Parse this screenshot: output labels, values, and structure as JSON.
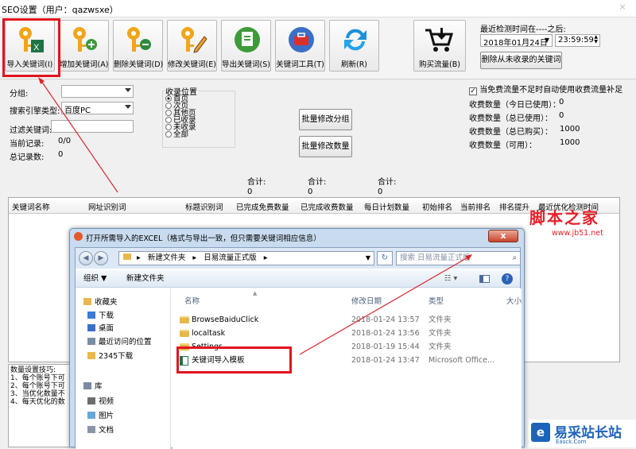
{
  "window": {
    "title": "SEO设置（用户：qazwsxe）",
    "close": "×"
  },
  "toolbar": {
    "buttons": [
      "导入关键词(I)",
      "增加关键词(A)",
      "删除关键词(D)",
      "修改关键词(E)",
      "导出关键词(S)",
      "关键词工具(T)",
      "刷新(R)"
    ],
    "buy_label": "购买流量(B)"
  },
  "detect": {
    "label": "最近检测时间在----之后:",
    "date": "2018年01月24日",
    "time": "23:59:59",
    "delete_btn": "删除从未收录的关键词"
  },
  "filters": {
    "group_label": "分组:",
    "engine_label": "搜索引擎类型:",
    "engine_value": "百度PC",
    "keyword_label": "过滤关键词:",
    "current_label": "当前记录:",
    "current_value": "0/0",
    "total_label": "总记录数:",
    "total_value": "0"
  },
  "position": {
    "label": "收录位置",
    "options": [
      "首页",
      "次页",
      "其他页",
      "已收录",
      "未收录",
      "全部"
    ],
    "selected": 0
  },
  "batch": {
    "group_btn": "批量修改分组",
    "count_btn": "批量修改数量"
  },
  "fees": {
    "checkbox": "当免费流量不足时自动使用收费流量补足",
    "rows": [
      {
        "label": "收费数量（今日已使用）：",
        "value": "0"
      },
      {
        "label": "收费数量（总已使用）：",
        "value": "0"
      },
      {
        "label": "收费数量（总已购买）：",
        "value": "1000"
      },
      {
        "label": "收费数量（可用）：",
        "value": "1000"
      }
    ]
  },
  "totals": [
    {
      "label": "合计:",
      "value": "0"
    },
    {
      "label": "合计:",
      "value": "0"
    },
    {
      "label": "合计:",
      "value": "0"
    }
  ],
  "grid": {
    "headers": [
      "关键词名称",
      "网址识别词",
      "标题识别词",
      "已完成免费数量",
      "已完成收费数量",
      "每日计划数量",
      "初始排名",
      "当前排名",
      "排名提升",
      "最近优化检测时间"
    ]
  },
  "tips": {
    "title": "数量设置技巧:",
    "lines": [
      "1、每个账号下可",
      "2、每个账号下可",
      "3、当优化数量不",
      "4、每天优化的数"
    ]
  },
  "dialog": {
    "title": "打开所需导入的EXCEL（格式与导出一致，但只需要关键词相应信息）",
    "close": "x",
    "path": [
      "新建文件夹",
      "日易流量正式版"
    ],
    "search_placeholder": "搜索 日易流量正式版",
    "cmd": {
      "organize": "组织 ▼",
      "new_folder": "新建文件夹"
    },
    "nav": [
      {
        "label": "收藏夹",
        "icon": "star-icon"
      },
      {
        "label": "下载",
        "icon": "download-folder-icon"
      },
      {
        "label": "桌面",
        "icon": "desktop-icon"
      },
      {
        "label": "最近访问的位置",
        "icon": "recent-places-icon"
      },
      {
        "label": "2345下载",
        "icon": "folder-icon"
      },
      {
        "label": "库",
        "icon": "library-icon"
      },
      {
        "label": "视频",
        "icon": "video-icon"
      },
      {
        "label": "图片",
        "icon": "picture-icon"
      },
      {
        "label": "文档",
        "icon": "document-icon"
      }
    ],
    "columns": [
      "名称",
      "修改日期",
      "类型",
      "大小"
    ],
    "files": [
      {
        "name": "BrowseBaiduClick",
        "date": "2018-01-24 13:57",
        "type": "文件夹",
        "icon": "folder-icon"
      },
      {
        "name": "localtask",
        "date": "2018-01-24 13:56",
        "type": "文件夹",
        "icon": "folder-icon"
      },
      {
        "name": "Settings",
        "date": "2018-01-19 15:44",
        "type": "文件夹",
        "icon": "folder-icon"
      },
      {
        "name": "关键词导入模板",
        "date": "2018-01-24 13:47",
        "type": "Microsoft Office...",
        "icon": "excel-file-icon"
      }
    ]
  },
  "watermarks": {
    "top": "脚本之家",
    "top_url": "www.jb51.net",
    "bottom": "易采站长站",
    "bottom_sub": "Easck.Com"
  },
  "colors": {
    "highlight": "#e2141c",
    "arrow": "#d9262c",
    "dialog_frame": "#c9dcef"
  }
}
